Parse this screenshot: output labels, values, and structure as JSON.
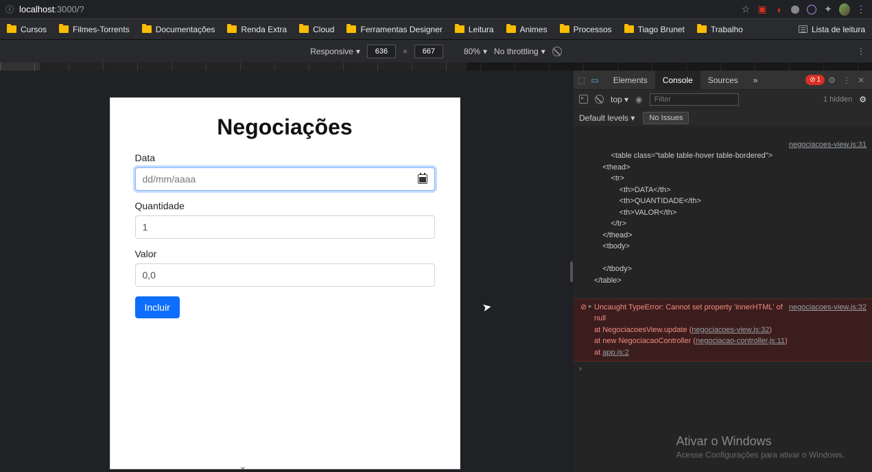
{
  "addr": {
    "url_host": "localhost",
    "url_rest": ":3000/?"
  },
  "bookmarks": [
    "Cursos",
    "Filmes-Torrents",
    "Documentações",
    "Renda Extra",
    "Cloud",
    "Ferramentas Designer",
    "Leitura",
    "Animes",
    "Processos",
    "Tiago Brunet",
    "Trabalho"
  ],
  "reading_list": "Lista de leitura",
  "device": {
    "mode": "Responsive",
    "w": "636",
    "h": "667",
    "zoom": "80%",
    "throttle": "No throttling"
  },
  "page": {
    "title": "Negociações",
    "label_data": "Data",
    "placeholder_data": "dd/mm/aaaa",
    "label_qtd": "Quantidade",
    "value_qtd": "1",
    "label_valor": "Valor",
    "value_valor": "0,0",
    "btn": "Incluir"
  },
  "devtools": {
    "tabs": [
      "Elements",
      "Console",
      "Sources"
    ],
    "more": "»",
    "err_count": "1",
    "top": "top",
    "filter_ph": "Filter",
    "hidden": "1 hidden",
    "levels": "Default levels",
    "issues": "No Issues",
    "log_src": "negociacoes-view.js:31",
    "html_log": "<table class=\"table table-hover table-bordered\">\n    <thead>\n        <tr>\n            <th>DATA</th>\n            <th>QUANTIDADE</th>\n            <th>VALOR</th>\n        </tr>\n    </thead>\n    <tbody>\n\n    </tbody>\n</table>",
    "err_src": "negociacoes-view.js:32",
    "err_l1": "Uncaught TypeError: Cannot set property 'innerHTML' of null",
    "err_l2": "    at NegociacoesView.update (",
    "err_l2_link": "negociacoes-view.js:32",
    "err_l3": "    at new NegociacaoController (",
    "err_l3_link": "negociacao-controller.js:11",
    "err_l4": "    at ",
    "err_l4_link": "app.js:2"
  },
  "watermark": {
    "title": "Ativar o Windows",
    "sub": "Acesse Configurações para ativar o Windows."
  }
}
